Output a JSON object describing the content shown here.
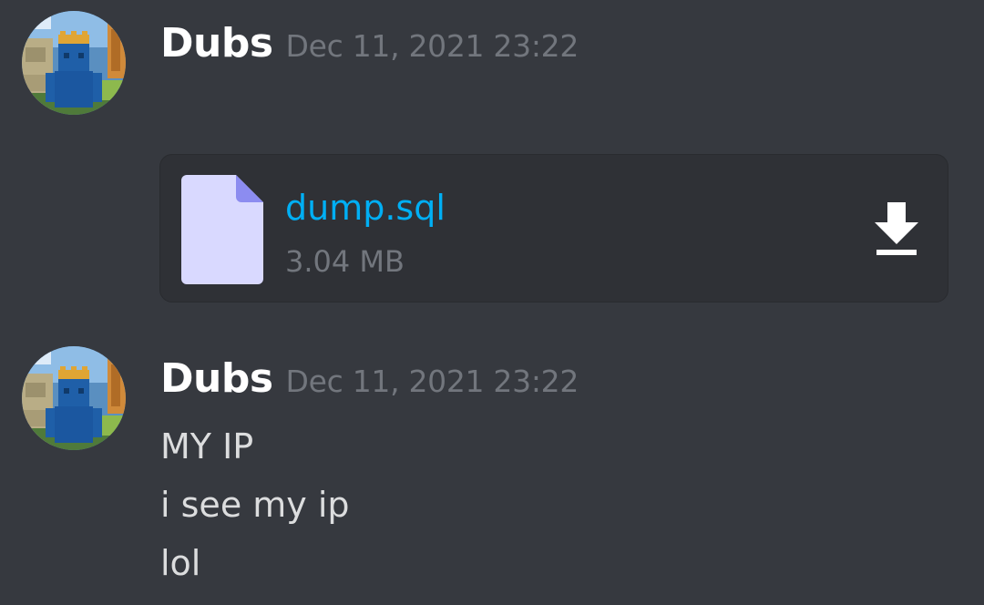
{
  "messages": [
    {
      "author": "Dubs",
      "timestamp": "Dec 11, 2021 23:22",
      "attachment": {
        "filename": "dump.sql",
        "size": "3.04 MB",
        "file_icon": "file-icon",
        "action_icon": "download-icon"
      }
    },
    {
      "author": "Dubs",
      "timestamp": "Dec 11, 2021 23:22",
      "lines": [
        "MY IP",
        "i see my ip",
        "lol"
      ]
    }
  ],
  "colors": {
    "background": "#36393f",
    "attachment_background": "#2f3136",
    "username": "#ffffff",
    "timestamp": "#72767d",
    "link": "#00aff4",
    "message_text": "#dcddde",
    "file_icon": "#d9d9ff"
  }
}
